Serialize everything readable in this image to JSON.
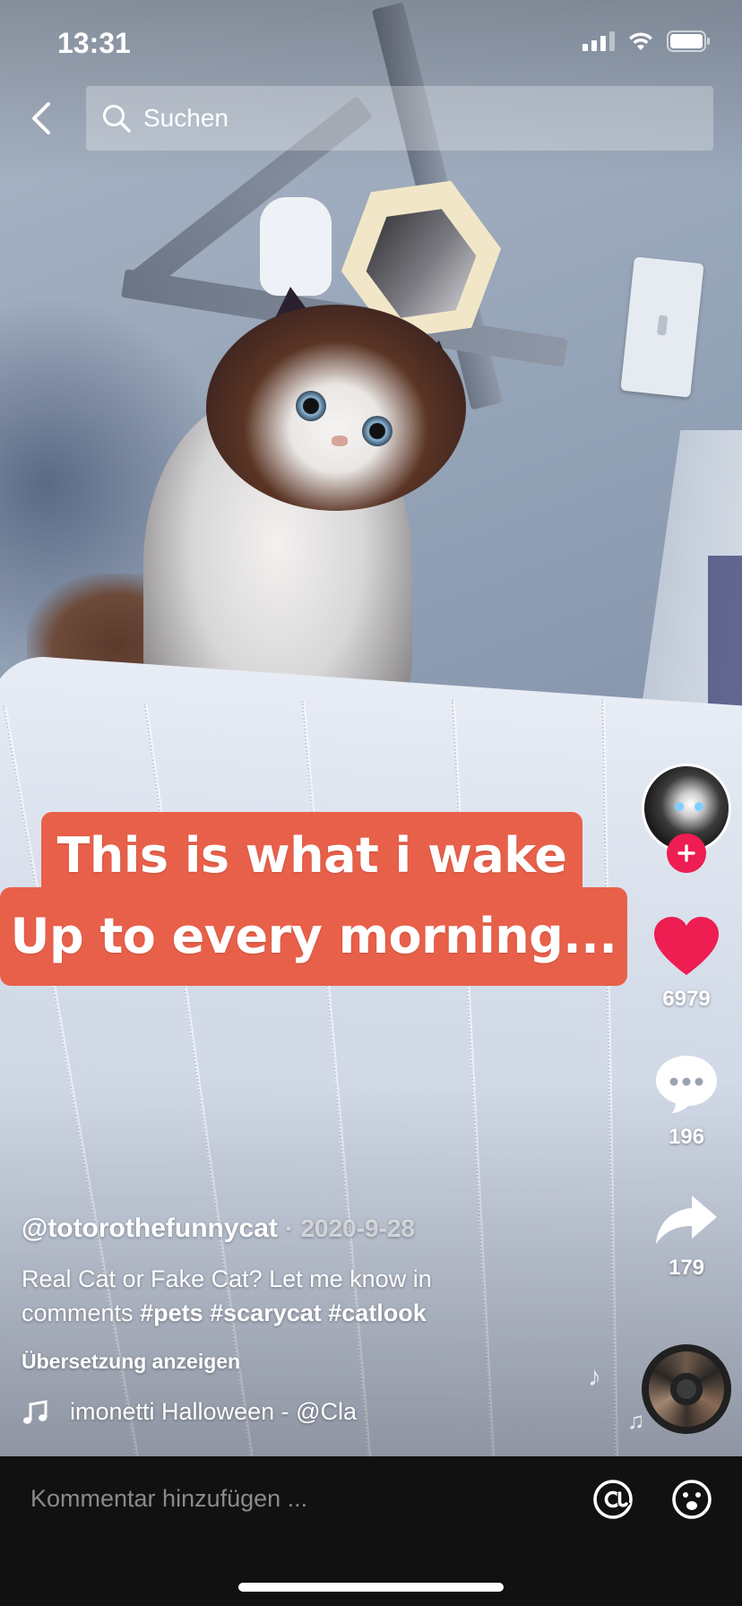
{
  "status_bar": {
    "time": "13:31"
  },
  "search": {
    "placeholder": "Suchen"
  },
  "video": {
    "caption_line1": "This is what i wake",
    "caption_line2": "Up to every morning..."
  },
  "actions": {
    "likes": "6979",
    "comments": "196",
    "shares": "179"
  },
  "post": {
    "username": "@totorothefunnycat",
    "date": "· 2020-9-28",
    "description": "Real Cat or Fake Cat? Let me know in comments",
    "hashtags": [
      "#pets",
      "#scarycat",
      "#catlook"
    ],
    "translate_label": "Übersetzung anzeigen",
    "music_track": "imonetti    Halloween - @Cla"
  },
  "comment_bar": {
    "placeholder": "Kommentar hinzufügen ..."
  },
  "colors": {
    "like_red": "#ee1d52",
    "sticker": "#e8604a",
    "comment_bar_bg": "#111111"
  }
}
